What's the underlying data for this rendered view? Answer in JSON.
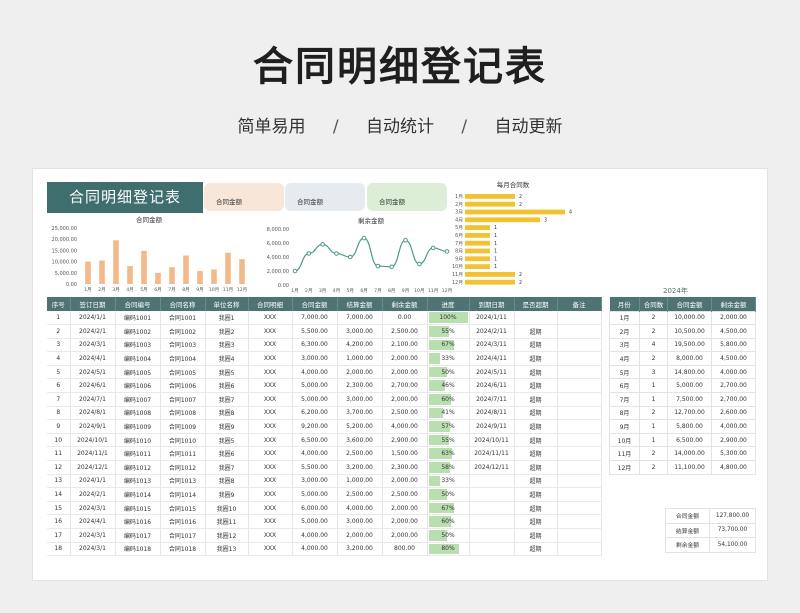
{
  "hero": {
    "title": "合同明细登记表",
    "tags": [
      "简单易用",
      "自动统计",
      "自动更新"
    ],
    "sep": "/"
  },
  "banner": "合同明细登记表",
  "kpis": [
    "合同金额",
    "合同金额",
    "合同金额"
  ],
  "colors": {
    "teal": "#3f6e6f",
    "header": "#4f7374",
    "bar_orange": "#f2b98a",
    "line_teal": "#4a9a8c",
    "bar_yellow": "#f2c230",
    "progress_green": "#b9deaf"
  },
  "chart_data": [
    {
      "type": "bar",
      "title": "合同金额",
      "categories": [
        "1月",
        "2月",
        "3月",
        "4月",
        "5月",
        "6月",
        "7月",
        "8月",
        "9月",
        "10月",
        "11月",
        "12月"
      ],
      "values": [
        10000,
        10500,
        19500,
        8000,
        14800,
        5000,
        7500,
        12700,
        5800,
        6500,
        14000,
        11100
      ],
      "ylim": [
        0,
        25000
      ],
      "yticks": [
        "0.00",
        "5,000.00",
        "10,000.00",
        "15,000.00",
        "20,000.00",
        "25,000.00"
      ],
      "grid": false
    },
    {
      "type": "line",
      "title": "剩余金额",
      "categories": [
        "1月",
        "2月",
        "3月",
        "4月",
        "5月",
        "6月",
        "7月",
        "8月",
        "9月",
        "10月",
        "11月",
        "12月"
      ],
      "values": [
        2000,
        4500,
        5800,
        4500,
        4000,
        6700,
        2700,
        2600,
        6400,
        3000,
        5300,
        4800
      ],
      "ylim": [
        0,
        8000
      ],
      "yticks": [
        "0.00",
        "2,000.00",
        "4,000.00",
        "6,000.00",
        "8,000.00"
      ],
      "grid": false
    },
    {
      "type": "bar",
      "orientation": "horizontal",
      "title": "每月合同数",
      "categories": [
        "1月",
        "2月",
        "3月",
        "4月",
        "5月",
        "6月",
        "7月",
        "8月",
        "9月",
        "10月",
        "11月",
        "12月"
      ],
      "values": [
        2,
        2,
        4,
        3,
        1,
        1,
        1,
        1,
        1,
        1,
        2,
        2
      ],
      "xlim": [
        0,
        4
      ]
    }
  ],
  "table": {
    "headers": [
      "序号",
      "签订日期",
      "合同编号",
      "合同名称",
      "单位名称",
      "合同明细",
      "合同金额",
      "结算金额",
      "剩余金额",
      "进度",
      "到期日期",
      "是否超期",
      "备注"
    ],
    "rows": [
      [
        "1",
        "2024/1/1",
        "编码1001",
        "合同1001",
        "我圈1",
        "XXX",
        "7,000.00",
        "7,000.00",
        "0.00",
        "100%",
        "2024/1/11",
        "",
        ""
      ],
      [
        "2",
        "2024/2/1",
        "编码1002",
        "合同1002",
        "我圈2",
        "XXX",
        "5,500.00",
        "3,000.00",
        "2,500.00",
        "55%",
        "2024/2/11",
        "超期",
        ""
      ],
      [
        "3",
        "2024/3/1",
        "编码1003",
        "合同1003",
        "我圈3",
        "XXX",
        "6,300.00",
        "4,200.00",
        "2,100.00",
        "67%",
        "2024/3/11",
        "超期",
        ""
      ],
      [
        "4",
        "2024/4/1",
        "编码1004",
        "合同1004",
        "我圈4",
        "XXX",
        "3,000.00",
        "1,000.00",
        "2,000.00",
        "33%",
        "2024/4/11",
        "超期",
        ""
      ],
      [
        "5",
        "2024/5/1",
        "编码1005",
        "合同1005",
        "我圈5",
        "XXX",
        "4,000.00",
        "2,000.00",
        "2,000.00",
        "50%",
        "2024/5/11",
        "超期",
        ""
      ],
      [
        "6",
        "2024/6/1",
        "编码1006",
        "合同1006",
        "我圈6",
        "XXX",
        "5,000.00",
        "2,300.00",
        "2,700.00",
        "46%",
        "2024/6/11",
        "超期",
        ""
      ],
      [
        "7",
        "2024/7/1",
        "编码1007",
        "合同1007",
        "我圈7",
        "XXX",
        "5,000.00",
        "3,000.00",
        "2,000.00",
        "60%",
        "2024/7/11",
        "超期",
        ""
      ],
      [
        "8",
        "2024/8/1",
        "编码1008",
        "合同1008",
        "我圈8",
        "XXX",
        "6,200.00",
        "3,700.00",
        "2,500.00",
        "41%",
        "2024/8/11",
        "超期",
        ""
      ],
      [
        "9",
        "2024/9/1",
        "编码1009",
        "合同1009",
        "我圈9",
        "XXX",
        "9,200.00",
        "5,200.00",
        "4,000.00",
        "57%",
        "2024/9/11",
        "超期",
        ""
      ],
      [
        "10",
        "2024/10/1",
        "编码1010",
        "合同1010",
        "我圈5",
        "XXX",
        "6,500.00",
        "3,600.00",
        "2,900.00",
        "55%",
        "2024/10/11",
        "超期",
        ""
      ],
      [
        "11",
        "2024/11/1",
        "编码1011",
        "合同1011",
        "我圈6",
        "XXX",
        "4,000.00",
        "2,500.00",
        "1,500.00",
        "63%",
        "2024/11/11",
        "超期",
        ""
      ],
      [
        "12",
        "2024/12/1",
        "编码1012",
        "合同1012",
        "我圈7",
        "XXX",
        "5,500.00",
        "3,200.00",
        "2,300.00",
        "58%",
        "2024/12/11",
        "超期",
        ""
      ],
      [
        "13",
        "2024/1/1",
        "编码1013",
        "合同1013",
        "我圈8",
        "XXX",
        "3,000.00",
        "1,000.00",
        "2,000.00",
        "33%",
        "",
        "超期",
        ""
      ],
      [
        "14",
        "2024/2/1",
        "编码1014",
        "合同1014",
        "我圈9",
        "XXX",
        "5,000.00",
        "2,500.00",
        "2,500.00",
        "50%",
        "",
        "超期",
        ""
      ],
      [
        "15",
        "2024/3/1",
        "编码1015",
        "合同1015",
        "我圈10",
        "XXX",
        "6,000.00",
        "4,000.00",
        "2,000.00",
        "67%",
        "",
        "超期",
        ""
      ],
      [
        "16",
        "2024/4/1",
        "编码1016",
        "合同1016",
        "我圈11",
        "XXX",
        "5,000.00",
        "3,000.00",
        "2,000.00",
        "60%",
        "",
        "超期",
        ""
      ],
      [
        "17",
        "2024/3/1",
        "编码1017",
        "合同1017",
        "我圈12",
        "XXX",
        "4,000.00",
        "2,000.00",
        "2,000.00",
        "50%",
        "",
        "超期",
        ""
      ],
      [
        "18",
        "2024/3/1",
        "编码1018",
        "合同1018",
        "我圈13",
        "XXX",
        "4,000.00",
        "3,200.00",
        "800.00",
        "80%",
        "",
        "超期",
        ""
      ]
    ],
    "progress": [
      1.0,
      0.55,
      0.67,
      0.33,
      0.5,
      0.46,
      0.6,
      0.41,
      0.57,
      0.55,
      0.63,
      0.58,
      0.33,
      0.5,
      0.67,
      0.6,
      0.5,
      0.8
    ]
  },
  "monthly": {
    "year": "2024年",
    "headers": [
      "月份",
      "合同数",
      "合同金额",
      "剩余金额"
    ],
    "rows": [
      [
        "1月",
        "2",
        "10,000.00",
        "2,000.00"
      ],
      [
        "2月",
        "2",
        "10,500.00",
        "4,500.00"
      ],
      [
        "3月",
        "4",
        "19,500.00",
        "5,800.00"
      ],
      [
        "4月",
        "2",
        "8,000.00",
        "4,500.00"
      ],
      [
        "5月",
        "3",
        "14,800.00",
        "4,000.00"
      ],
      [
        "6月",
        "1",
        "5,000.00",
        "2,700.00"
      ],
      [
        "7月",
        "1",
        "7,500.00",
        "2,700.00"
      ],
      [
        "8月",
        "2",
        "12,700.00",
        "2,600.00"
      ],
      [
        "9月",
        "1",
        "5,800.00",
        "4,000.00"
      ],
      [
        "10月",
        "1",
        "6,500.00",
        "2,900.00"
      ],
      [
        "11月",
        "2",
        "14,000.00",
        "5,300.00"
      ],
      [
        "12月",
        "2",
        "11,100.00",
        "4,800.00"
      ]
    ]
  },
  "summary": [
    [
      "合同金额",
      "127,800.00"
    ],
    [
      "结算金额",
      "73,700.00"
    ],
    [
      "剩余金额",
      "54,100.00"
    ]
  ]
}
